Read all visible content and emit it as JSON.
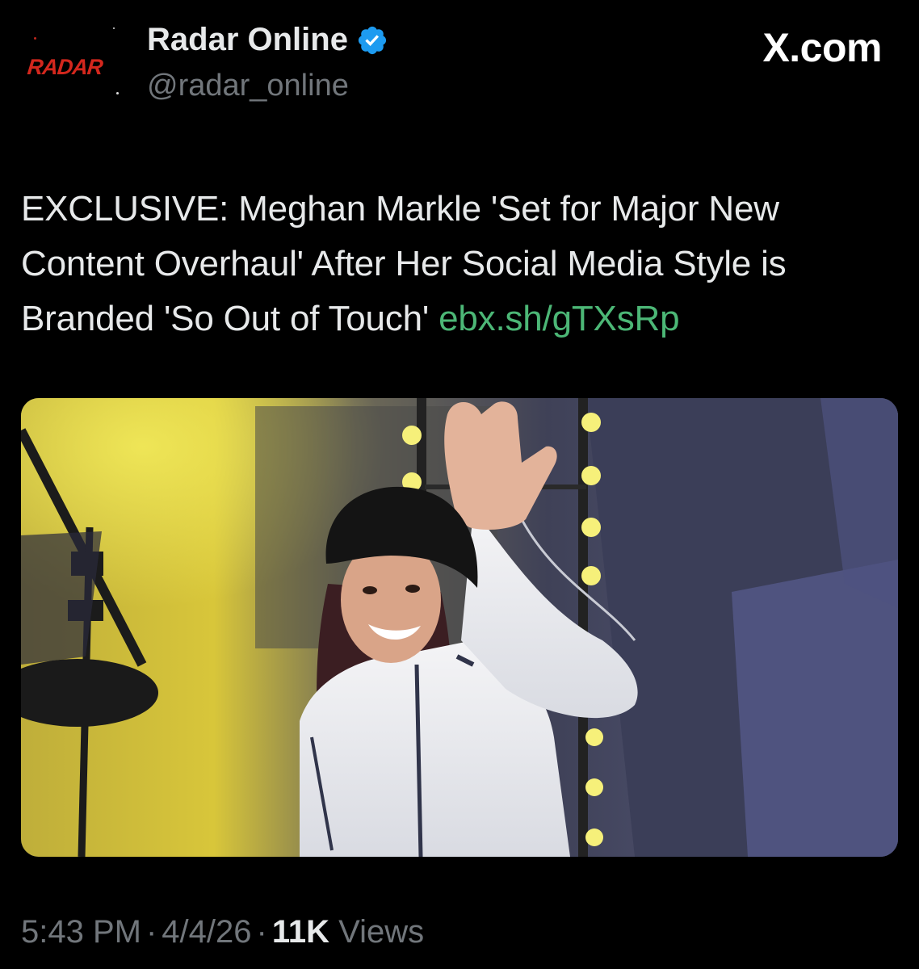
{
  "author": {
    "avatar_logo_text": "RADAR",
    "display_name": "Radar Online",
    "handle": "@radar_online",
    "verified": true
  },
  "site_badge": "X.com",
  "tweet": {
    "text": "EXCLUSIVE: Meghan Markle 'Set for Major New Content Overhaul' After Her Social Media Style is Branded 'So Out of Touch' ",
    "link": "ebx.sh/gTXsRp"
  },
  "media": {
    "kind": "photo"
  },
  "footer": {
    "time": "5:43 PM",
    "date": "4/4/26",
    "separator": "·",
    "views_count": "11K",
    "views_label": "Views"
  },
  "colors": {
    "background": "#000000",
    "text_primary": "#e7e9ea",
    "text_secondary": "#71767b",
    "link": "#4cb776",
    "verified": "#1d9bf0",
    "brand_logo": "#d3271d"
  },
  "icons": {
    "verified": "verified-badge-icon"
  }
}
